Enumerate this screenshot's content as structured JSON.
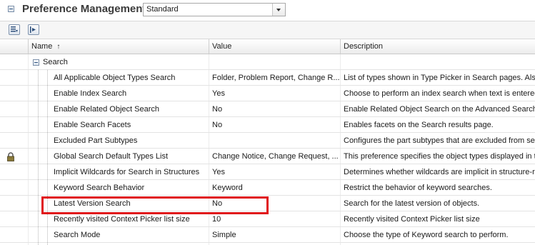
{
  "title": "Preference Management",
  "preference_set": {
    "selected": "Standard"
  },
  "columns": {
    "name": "Name",
    "value": "Value",
    "description": "Description"
  },
  "group": {
    "label": "Search"
  },
  "rows": [
    {
      "name": "All Applicable Object Types Search",
      "value": "Folder, Problem Report, Change R...",
      "description": "List of types shown in Type Picker in Search pages. Also",
      "locked": false
    },
    {
      "name": "Enable Index Search",
      "value": "Yes",
      "description": "Choose to perform an index search when text is entered",
      "locked": false
    },
    {
      "name": "Enable Related Object Search",
      "value": "No",
      "description": "Enable Related Object Search on the Advanced Search",
      "locked": false
    },
    {
      "name": "Enable Search Facets",
      "value": "No",
      "description": "Enables facets on the Search results page.",
      "locked": false
    },
    {
      "name": "Excluded Part Subtypes",
      "value": "",
      "description": "Configures the part subtypes that are excluded from se",
      "locked": false
    },
    {
      "name": "Global Search Default Types List",
      "value": "Change Notice, Change Request, ...",
      "description": "This preference specifies the object types displayed in t",
      "locked": true
    },
    {
      "name": "Implicit Wildcards for Search in Structures",
      "value": "Yes",
      "description": "Determines whether wildcards are implicit in structure-r",
      "locked": false
    },
    {
      "name": "Keyword Search Behavior",
      "value": "Keyword",
      "description": "Restrict the behavior of keyword searches.",
      "locked": false
    },
    {
      "name": "Latest Version Search",
      "value": "No",
      "description": "Search for the latest version of objects.",
      "locked": false
    },
    {
      "name": "Recently visited Context Picker list size",
      "value": "10",
      "description": "Recently visited Context Picker list size",
      "locked": false
    },
    {
      "name": "Search Mode",
      "value": "Simple",
      "description": "Choose the type of Keyword search to perform.",
      "locked": false
    }
  ],
  "highlight_color": "#e0161b"
}
